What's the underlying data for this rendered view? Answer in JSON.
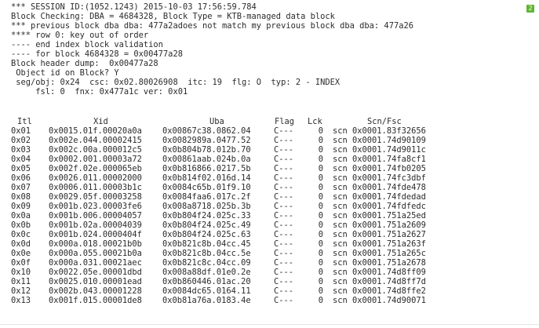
{
  "badge": "2",
  "header_lines": [
    "*** SESSION ID:(1052.1243) 2015-10-03 17:56:59.784",
    "Block Checking: DBA = 4684328, Block Type = KTB-managed data block",
    "*** previous block dba dba: 477a2adoes not match my previous block dba dba: 477a26",
    "**** row 0: key out of order",
    "---- end index block validation",
    "---- for block 4684328 = 0x00477a28",
    "Block header dump:  0x00477a28",
    " Object id on Block? Y",
    " seg/obj: 0x24  csc: 0x02.80026908  itc: 19  flg: O  typ: 2 - INDEX",
    "     fsl: 0  fnx: 0x477a1c ver: 0x01"
  ],
  "columns": [
    "Itl",
    "Xid",
    "Uba",
    "Flag",
    "Lck",
    "Scn/Fsc"
  ],
  "rows": [
    [
      "0x01",
      "0x0015.01f.00020a0a",
      "0x00867c38.0862.04",
      "C---",
      "0",
      "scn 0x0001.83f32656"
    ],
    [
      "0x02",
      "0x002e.044.00002415",
      "0x0082989a.0477.52",
      "C---",
      "0",
      "scn 0x0001.74d90109"
    ],
    [
      "0x03",
      "0x002c.00a.000012c5",
      "0x0b804b78.012b.70",
      "C---",
      "0",
      "scn 0x0001.74d9011c"
    ],
    [
      "0x04",
      "0x0002.001.00003a72",
      "0x00861aab.024b.0a",
      "C---",
      "0",
      "scn 0x0001.74fa8cf1"
    ],
    [
      "0x05",
      "0x002f.02e.000065eb",
      "0x0b816866.0217.5b",
      "C---",
      "0",
      "scn 0x0001.74fb0205"
    ],
    [
      "0x06",
      "0x0026.011.00002000",
      "0x0b814f02.016d.14",
      "C---",
      "0",
      "scn 0x0001.74fc3dbf"
    ],
    [
      "0x07",
      "0x0006.011.00003b1c",
      "0x0084c65b.01f9.10",
      "C---",
      "0",
      "scn 0x0001.74fde478"
    ],
    [
      "0x08",
      "0x0029.05f.00003258",
      "0x0084faa6.017c.2f",
      "C---",
      "0",
      "scn 0x0001.74fdedad"
    ],
    [
      "0x09",
      "0x001b.023.00003fe6",
      "0x008a8718.025b.3b",
      "C---",
      "0",
      "scn 0x0001.74fdfedc"
    ],
    [
      "0x0a",
      "0x001b.006.00004057",
      "0x0b804f24.025c.33",
      "C---",
      "0",
      "scn 0x0001.751a25ed"
    ],
    [
      "0x0b",
      "0x001b.02a.00004039",
      "0x0b804f24.025c.49",
      "C---",
      "0",
      "scn 0x0001.751a2609"
    ],
    [
      "0x0c",
      "0x001b.024.0000404f",
      "0x0b804f24.025c.63",
      "C---",
      "0",
      "scn 0x0001.751a2627"
    ],
    [
      "0x0d",
      "0x000a.018.00021b0b",
      "0x0b821c8b.04cc.45",
      "C---",
      "0",
      "scn 0x0001.751a263f"
    ],
    [
      "0x0e",
      "0x000a.055.00021b0a",
      "0x0b821c8b.04cc.5e",
      "C---",
      "0",
      "scn 0x0001.751a265c"
    ],
    [
      "0x0f",
      "0x000a.031.00021aec",
      "0x0b821c8c.04cc.09",
      "C---",
      "0",
      "scn 0x0001.751a2678"
    ],
    [
      "0x10",
      "0x0022.05e.00001dbd",
      "0x008a88df.01e0.2e",
      "C---",
      "0",
      "scn 0x0001.74d8ff09"
    ],
    [
      "0x11",
      "0x0025.010.00001ead",
      "0x0b860446.01ac.20",
      "C---",
      "0",
      "scn 0x0001.74d8ff7d"
    ],
    [
      "0x12",
      "0x002b.043.00001228",
      "0x0084dc65.0164.11",
      "C---",
      "0",
      "scn 0x0001.74d8ffe2"
    ],
    [
      "0x13",
      "0x001f.015.00001de8",
      "0x0b81a76a.0183.4e",
      "C---",
      "0",
      "scn 0x0001.74d90071"
    ]
  ]
}
